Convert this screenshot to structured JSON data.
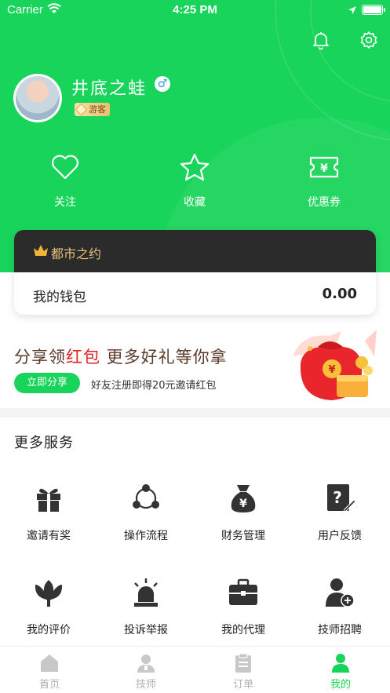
{
  "status_bar": {
    "carrier": "Carrier",
    "time": "4:25 PM"
  },
  "header": {
    "icons": [
      "bell-icon",
      "settings-icon"
    ],
    "user": {
      "name": "井底之蛙",
      "gender_symbol": "♂",
      "level_badge": "游客"
    },
    "actions": [
      {
        "label": "关注",
        "icon": "heart-icon"
      },
      {
        "label": "收藏",
        "icon": "star-icon"
      },
      {
        "label": "优惠券",
        "icon": "coupon-icon"
      }
    ]
  },
  "wallet": {
    "brand": "都市之约",
    "label": "我的钱包",
    "amount": "0.00"
  },
  "promo": {
    "title_part1": "分享领",
    "title_red": "红包",
    "title_part2": " 更多好礼等你拿",
    "button": "立即分享",
    "subtitle": "好友注册即得20元邀请红包"
  },
  "services": {
    "title": "更多服务",
    "items": [
      {
        "label": "邀请有奖",
        "icon": "gift-icon"
      },
      {
        "label": "操作流程",
        "icon": "process-icon"
      },
      {
        "label": "财务管理",
        "icon": "money-bag-icon"
      },
      {
        "label": "用户反馈",
        "icon": "feedback-icon"
      },
      {
        "label": "我的评价",
        "icon": "flower-icon"
      },
      {
        "label": "投诉举报",
        "icon": "alarm-icon"
      },
      {
        "label": "我的代理",
        "icon": "briefcase-icon"
      },
      {
        "label": "技师招聘",
        "icon": "add-user-icon"
      }
    ]
  },
  "tabbar": {
    "active": "我的",
    "items": [
      {
        "label": "首页",
        "icon": "home-icon"
      },
      {
        "label": "技师",
        "icon": "technician-icon"
      },
      {
        "label": "订单",
        "icon": "order-icon"
      },
      {
        "label": "我的",
        "icon": "profile-icon"
      }
    ]
  },
  "colors": {
    "primary": "#19d45a",
    "accent_red": "#e02020",
    "card_dark": "#2b2b2b",
    "gold": "#e9c07a"
  }
}
